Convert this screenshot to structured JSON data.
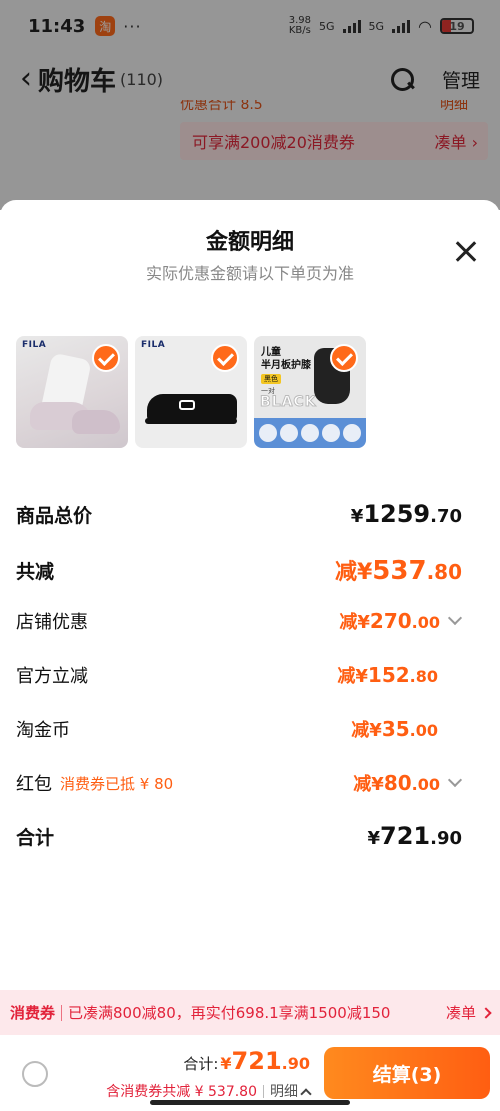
{
  "status_bar": {
    "time": "11:43",
    "app_badge": "淘",
    "dots": "···",
    "net_speed_value": "3.98",
    "net_speed_unit": "KB/s",
    "network_1": "5G",
    "network_2": "5G",
    "battery": "19"
  },
  "cart_header": {
    "back": "‹",
    "title": "购物车",
    "count": "(110)",
    "manage": "管理"
  },
  "underlay": {
    "cut_text_left": "优惠合计 8.5",
    "cut_text_right": "明细",
    "coupon_text": "可享满200减20消费券",
    "coupon_action": "凑单 ›"
  },
  "sheet": {
    "title": "金额明细",
    "subtitle": "实际优惠金额请以下单页为准",
    "items": [
      {
        "brand": "FILA"
      },
      {
        "brand": "FILA"
      },
      {
        "title_line1": "儿童",
        "title_line2": "半月板护膝",
        "tag": "黑色",
        "pair": "一对",
        "word": "BLACK"
      }
    ]
  },
  "details": {
    "subtotal": {
      "label": "商品总价",
      "sym": "¥",
      "int": "1259",
      "dec": ".70"
    },
    "total_discount": {
      "label": "共减",
      "sym": "减¥",
      "int": "537",
      "dec": ".80"
    },
    "store": {
      "label": "店铺优惠",
      "sym": "减¥",
      "int": "270",
      "dec": ".00"
    },
    "official": {
      "label": "官方立减",
      "sym": "减¥",
      "int": "152",
      "dec": ".80"
    },
    "coins": {
      "label": "淘金币",
      "sym": "减¥",
      "int": "35",
      "dec": ".00"
    },
    "redpacket": {
      "label": "红包",
      "note": "消费券已抵 ¥ 80",
      "sym": "减¥",
      "int": "80",
      "dec": ".00"
    },
    "total": {
      "label": "合计",
      "sym": "¥",
      "int": "721",
      "dec": ".90"
    }
  },
  "promo": {
    "label": "消费券",
    "text": "已凑满800减80，再实付698.1享满1500减150",
    "action": "凑单"
  },
  "checkout": {
    "total_label": "合计:",
    "sym": "¥",
    "int": "721",
    "dec": ".90",
    "discount_text": "含消费券共减 ¥ 537.80",
    "detail_link": "明细",
    "button": "结算(3)"
  },
  "colors": {
    "accent": "#ff5e12",
    "promo_red": "#e2233b",
    "button_gradient_start": "#ff8a1e"
  }
}
